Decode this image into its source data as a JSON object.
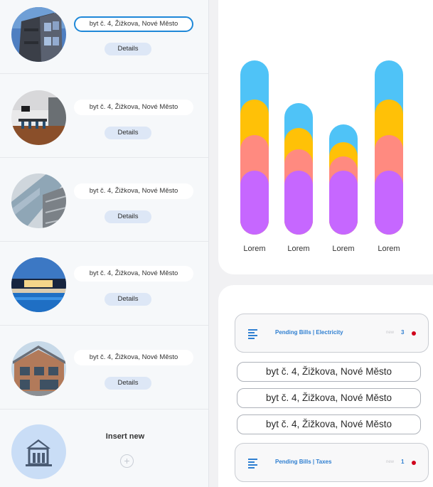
{
  "properties": [
    {
      "address": "byt č. 4, Žižkova, Nové Město",
      "details_label": "Details",
      "photo": "building-photo",
      "active": true
    },
    {
      "address": "byt č. 4, Žižkova, Nové Město",
      "details_label": "Details",
      "photo": "interior-photo",
      "active": false
    },
    {
      "address": "byt č. 4, Žižkova, Nové Město",
      "details_label": "Details",
      "photo": "glass-facade-photo",
      "active": false
    },
    {
      "address": "byt č. 4, Žižkova, Nové Město",
      "details_label": "Details",
      "photo": "pool-villa-photo",
      "active": false
    },
    {
      "address": "byt č. 4, Žižkova, Nové Město",
      "details_label": "Details",
      "photo": "wooden-house-photo",
      "active": false
    }
  ],
  "insert": {
    "label": "Insert new",
    "icon": "house-icon",
    "plus": "+"
  },
  "chart_data": {
    "type": "bar",
    "stacked": true,
    "categories": [
      "Lorem",
      "Lorem",
      "Lorem",
      "Lorem"
    ],
    "series": [
      {
        "color": "#c667ff",
        "values": [
          90,
          90,
          90,
          90
        ]
      },
      {
        "color": "#ff8a80",
        "values": [
          50,
          30,
          20,
          50
        ]
      },
      {
        "color": "#ffc107",
        "values": [
          50,
          30,
          20,
          50
        ]
      },
      {
        "color": "#4fc3f7",
        "values": [
          55,
          35,
          25,
          55
        ]
      }
    ],
    "ylim": [
      0,
      245
    ]
  },
  "bills": [
    {
      "title": "Pending Bills | Electricity",
      "new_label": "new",
      "count": "3",
      "icon": "list-lines-icon"
    },
    {
      "title": "Pending Bills | Taxes",
      "new_label": "new",
      "count": "1",
      "icon": "list-lines-icon"
    }
  ],
  "bill_addresses": [
    "byt č. 4, Žižkova, Nové Město",
    "byt č. 4, Žižkova, Nové Město",
    "byt č. 4, Žižkova, Nové Město"
  ]
}
